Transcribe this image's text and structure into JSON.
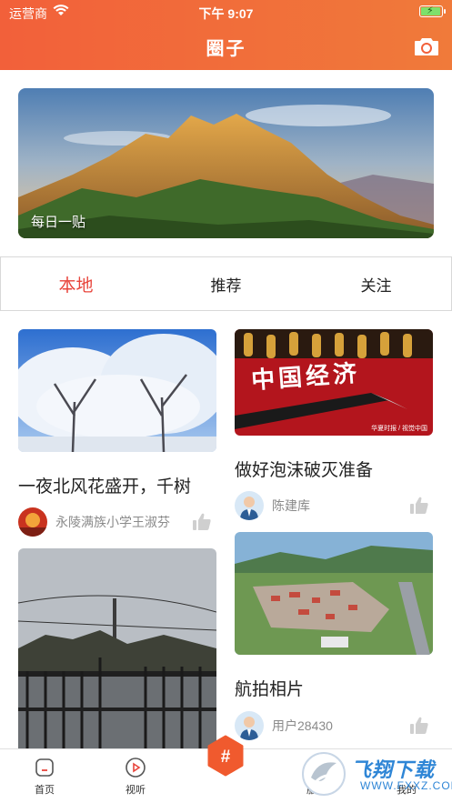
{
  "status_bar": {
    "carrier": "运营商",
    "time": "下午 9:07",
    "battery_level": 1.0
  },
  "header": {
    "title": "圈子",
    "camera_icon": "camera-icon"
  },
  "banner": {
    "label": "每日一贴"
  },
  "tabs": [
    {
      "label": "本地",
      "active": true
    },
    {
      "label": "推荐",
      "active": false
    },
    {
      "label": "关注",
      "active": false
    }
  ],
  "feed": {
    "left": [
      {
        "title": "一夜北风花盛开，千树",
        "author": "永陵满族小学王淑芬"
      },
      {
        "title": "",
        "author": ""
      }
    ],
    "right": [
      {
        "title": "做好泡沫破灭准备",
        "author": "陈建库",
        "image_text": "中国经济",
        "image_caption": "华夏时报 / 视觉中国"
      },
      {
        "title": "航拍相片",
        "author": "用户28430"
      }
    ]
  },
  "tabbar": [
    {
      "label": "首页",
      "icon": "home-icon"
    },
    {
      "label": "视听",
      "icon": "play-icon"
    },
    {
      "label": "#",
      "icon": "hashtag-icon"
    },
    {
      "label": "服务",
      "icon": "service-icon"
    },
    {
      "label": "我的",
      "icon": "user-icon"
    }
  ],
  "watermark": {
    "main": "飞翔下载",
    "sub": "WWW.FXXZ.COM"
  },
  "colors": {
    "accent": "#e8453c",
    "header": "#f2603a",
    "hash_button": "#f05a2e"
  }
}
